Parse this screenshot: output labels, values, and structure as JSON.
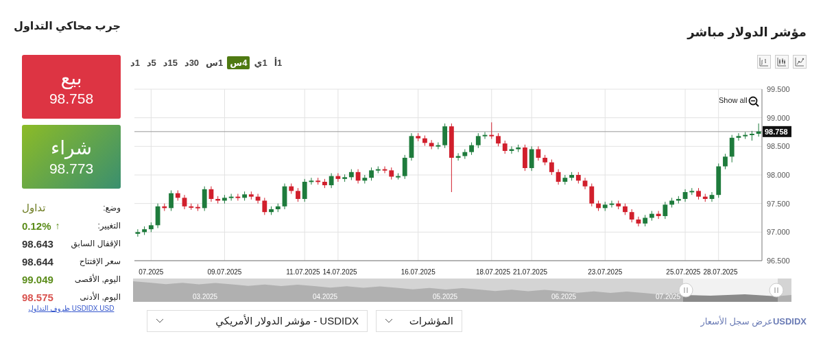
{
  "header": {
    "chart_title": "مؤشر الدولار مباشر",
    "simulator_title": "جرب محاكي التداول"
  },
  "trade_buttons": [
    {
      "kind": "sell",
      "label": "بيع",
      "price": "98.758"
    },
    {
      "kind": "buy",
      "label": "شراء",
      "price": "98.773"
    }
  ],
  "stats": [
    {
      "label": "وضع:",
      "value": "تداول",
      "color": "#6b7a1f"
    },
    {
      "label": "التغيير:",
      "value": "0.12%",
      "arrow": "↑",
      "color": "#5b8c1a"
    },
    {
      "label": "الإقفال السابق",
      "value": "98.643",
      "color": "#333333"
    },
    {
      "label": "سعر الإفتتاح",
      "value": "98.644",
      "color": "#333333"
    },
    {
      "label": "اليوم, الأقصى",
      "value": "99.049",
      "color": "#5b8c1a"
    },
    {
      "label": "اليوم, الأدنى",
      "value": "98.575",
      "color": "#d9534f"
    }
  ],
  "trading_conditions_link": "USDIDX USD ظروف التداول",
  "timeframes": [
    {
      "label": "1أ",
      "selected": false
    },
    {
      "label": "1ي",
      "selected": false
    },
    {
      "label": "4س",
      "selected": true
    },
    {
      "label": "1س",
      "selected": false
    },
    {
      "label": "30د",
      "selected": false
    },
    {
      "label": "15د",
      "selected": false
    },
    {
      "label": "5د",
      "selected": false
    },
    {
      "label": "1د",
      "selected": false
    }
  ],
  "chart_types": [
    {
      "kind": "line"
    },
    {
      "kind": "candles"
    },
    {
      "kind": "bars"
    }
  ],
  "chart": {
    "show_all": "Show all",
    "chart_data": {
      "type": "candlestick",
      "grid": true,
      "ylim": [
        96.5,
        99.5
      ],
      "yticks": [
        {
          "value": 99.5,
          "label": "99.500"
        },
        {
          "value": 99,
          "label": "99.000"
        },
        {
          "value": 98.5,
          "label": "98.500"
        },
        {
          "value": 98,
          "label": "98.000"
        },
        {
          "value": 97.5,
          "label": "97.500"
        },
        {
          "value": 97,
          "label": "97.000"
        },
        {
          "value": 96.5,
          "label": "96.500"
        }
      ],
      "categories": [
        null,
        null,
        "07.2025",
        null,
        null,
        null,
        null,
        null,
        null,
        null,
        null,
        null,
        null,
        "09.07.2025",
        null,
        null,
        null,
        null,
        null,
        null,
        null,
        null,
        null,
        null,
        null,
        "11.07.2025",
        null,
        null,
        null,
        null,
        "14.07.2025",
        null,
        null,
        null,
        null,
        null,
        null,
        null,
        null,
        null,
        null,
        null,
        "16.07.2025",
        null,
        null,
        null,
        null,
        null,
        null,
        null,
        null,
        null,
        null,
        "18.07.2025",
        null,
        null,
        null,
        null,
        null,
        "21.07.2025",
        null,
        null,
        null,
        null,
        null,
        null,
        null,
        null,
        null,
        null,
        "23.07.2025",
        null,
        null,
        null,
        null,
        null,
        null,
        null,
        null,
        null,
        null,
        null,
        "25.07.2025",
        null,
        null,
        null,
        null,
        "28.07.2025",
        null,
        null,
        null,
        null,
        null,
        null
      ],
      "ref_lines": [
        {
          "axis": "y",
          "value": 98.758,
          "label": "98.758"
        }
      ],
      "ohlc": [
        [
          96.97,
          97.05,
          96.92,
          97.0
        ],
        [
          97.0,
          97.1,
          96.95,
          97.05
        ],
        [
          97.05,
          97.17,
          97.0,
          97.12
        ],
        [
          97.12,
          97.5,
          97.07,
          97.45
        ],
        [
          97.45,
          97.5,
          97.37,
          97.42
        ],
        [
          97.42,
          97.73,
          97.37,
          97.68
        ],
        [
          97.68,
          97.73,
          97.55,
          97.6
        ],
        [
          97.6,
          97.65,
          97.4,
          97.45
        ],
        [
          97.45,
          97.5,
          97.39,
          97.44
        ],
        [
          97.44,
          97.49,
          97.37,
          97.42
        ],
        [
          97.42,
          97.8,
          97.37,
          97.75
        ],
        [
          97.75,
          97.8,
          97.53,
          97.58
        ],
        [
          97.58,
          97.63,
          97.5,
          97.55
        ],
        [
          97.55,
          97.65,
          97.5,
          97.6
        ],
        [
          97.6,
          97.67,
          97.55,
          97.62
        ],
        [
          97.62,
          97.67,
          97.55,
          97.6
        ],
        [
          97.6,
          97.71,
          97.55,
          97.66
        ],
        [
          97.66,
          97.71,
          97.57,
          97.62
        ],
        [
          97.62,
          97.67,
          97.5,
          97.55
        ],
        [
          97.55,
          97.6,
          97.3,
          97.35
        ],
        [
          97.35,
          97.45,
          97.3,
          97.4
        ],
        [
          97.4,
          97.5,
          97.35,
          97.45
        ],
        [
          97.45,
          97.85,
          97.4,
          97.8
        ],
        [
          97.8,
          97.85,
          97.67,
          97.72
        ],
        [
          97.72,
          97.77,
          97.53,
          97.58
        ],
        [
          97.58,
          97.93,
          97.53,
          97.88
        ],
        [
          97.88,
          97.95,
          97.83,
          97.9
        ],
        [
          97.9,
          97.95,
          97.83,
          97.88
        ],
        [
          97.88,
          97.93,
          97.77,
          97.82
        ],
        [
          97.82,
          98.03,
          97.77,
          97.98
        ],
        [
          97.98,
          98.03,
          97.88,
          97.93
        ],
        [
          97.93,
          98.01,
          97.88,
          97.96
        ],
        [
          97.96,
          98.1,
          97.91,
          98.05
        ],
        [
          98.05,
          98.1,
          97.85,
          97.9
        ],
        [
          97.9,
          98.0,
          97.85,
          97.95
        ],
        [
          97.95,
          98.13,
          97.9,
          98.08
        ],
        [
          98.08,
          98.15,
          98.03,
          98.1
        ],
        [
          98.1,
          98.15,
          98.03,
          98.08
        ],
        [
          98.08,
          98.13,
          97.92,
          97.97
        ],
        [
          97.97,
          98.03,
          97.92,
          97.98
        ],
        [
          97.98,
          98.35,
          97.93,
          98.3
        ],
        [
          98.3,
          98.73,
          98.25,
          98.68
        ],
        [
          98.68,
          98.73,
          98.59,
          98.64
        ],
        [
          98.64,
          98.69,
          98.51,
          98.56
        ],
        [
          98.56,
          98.61,
          98.45,
          98.5
        ],
        [
          98.5,
          98.57,
          98.45,
          98.52
        ],
        [
          98.52,
          98.9,
          98.47,
          98.85
        ],
        [
          98.85,
          98.9,
          97.7,
          98.3
        ],
        [
          98.3,
          98.38,
          98.25,
          98.33
        ],
        [
          98.33,
          98.45,
          98.28,
          98.4
        ],
        [
          98.4,
          98.57,
          98.35,
          98.52
        ],
        [
          98.52,
          98.73,
          98.47,
          98.68
        ],
        [
          98.68,
          98.75,
          98.63,
          98.7
        ],
        [
          98.7,
          98.92,
          98.63,
          98.68
        ],
        [
          98.68,
          98.73,
          98.5,
          98.55
        ],
        [
          98.55,
          98.6,
          98.37,
          98.42
        ],
        [
          98.42,
          98.5,
          98.37,
          98.45
        ],
        [
          98.45,
          98.53,
          98.4,
          98.48
        ],
        [
          98.48,
          98.53,
          98.07,
          98.12
        ],
        [
          98.12,
          98.5,
          98.07,
          98.45
        ],
        [
          98.45,
          98.5,
          98.25,
          98.3
        ],
        [
          98.3,
          98.35,
          98.17,
          98.22
        ],
        [
          98.22,
          98.27,
          98.0,
          98.05
        ],
        [
          98.05,
          98.1,
          97.83,
          97.88
        ],
        [
          97.88,
          98.0,
          97.83,
          97.95
        ],
        [
          97.95,
          98.05,
          97.9,
          98.0
        ],
        [
          98.0,
          98.05,
          97.85,
          97.9
        ],
        [
          97.9,
          97.95,
          97.75,
          97.8
        ],
        [
          97.8,
          97.85,
          97.45,
          97.5
        ],
        [
          97.5,
          97.55,
          97.37,
          97.42
        ],
        [
          97.42,
          97.53,
          97.37,
          97.48
        ],
        [
          97.48,
          97.55,
          97.43,
          97.5
        ],
        [
          97.5,
          97.55,
          97.4,
          97.45
        ],
        [
          97.45,
          97.5,
          97.3,
          97.35
        ],
        [
          97.35,
          97.4,
          97.17,
          97.22
        ],
        [
          97.22,
          97.27,
          97.1,
          97.15
        ],
        [
          97.15,
          97.3,
          97.1,
          97.25
        ],
        [
          97.25,
          97.37,
          97.2,
          97.32
        ],
        [
          97.32,
          97.37,
          97.23,
          97.28
        ],
        [
          97.28,
          97.53,
          97.23,
          97.48
        ],
        [
          97.48,
          97.6,
          97.43,
          97.55
        ],
        [
          97.55,
          97.63,
          97.5,
          97.58
        ],
        [
          97.58,
          97.75,
          97.53,
          97.7
        ],
        [
          97.7,
          97.77,
          97.65,
          97.72
        ],
        [
          97.72,
          97.77,
          97.57,
          97.62
        ],
        [
          97.62,
          97.67,
          97.53,
          97.58
        ],
        [
          97.58,
          97.7,
          97.53,
          97.65
        ],
        [
          97.65,
          98.2,
          97.6,
          98.15
        ],
        [
          98.15,
          98.37,
          98.1,
          98.32
        ],
        [
          98.32,
          98.7,
          98.22,
          98.65
        ],
        [
          98.65,
          98.73,
          98.6,
          98.68
        ],
        [
          98.68,
          98.75,
          98.63,
          98.7
        ],
        [
          98.7,
          98.77,
          98.6,
          98.72
        ],
        [
          98.72,
          98.9,
          98.67,
          98.76
        ]
      ]
    }
  },
  "navigator": {
    "labels": [
      "07.2025",
      "06.2025",
      "05.2025",
      "04.2025",
      "03.2025"
    ]
  },
  "bottom": {
    "instrument_select": "USDIDX - مؤشر الدولار الأمريكي",
    "category_select": "المؤشرات",
    "history_link": "**USDIDX**عرض سجل الأسعار"
  }
}
